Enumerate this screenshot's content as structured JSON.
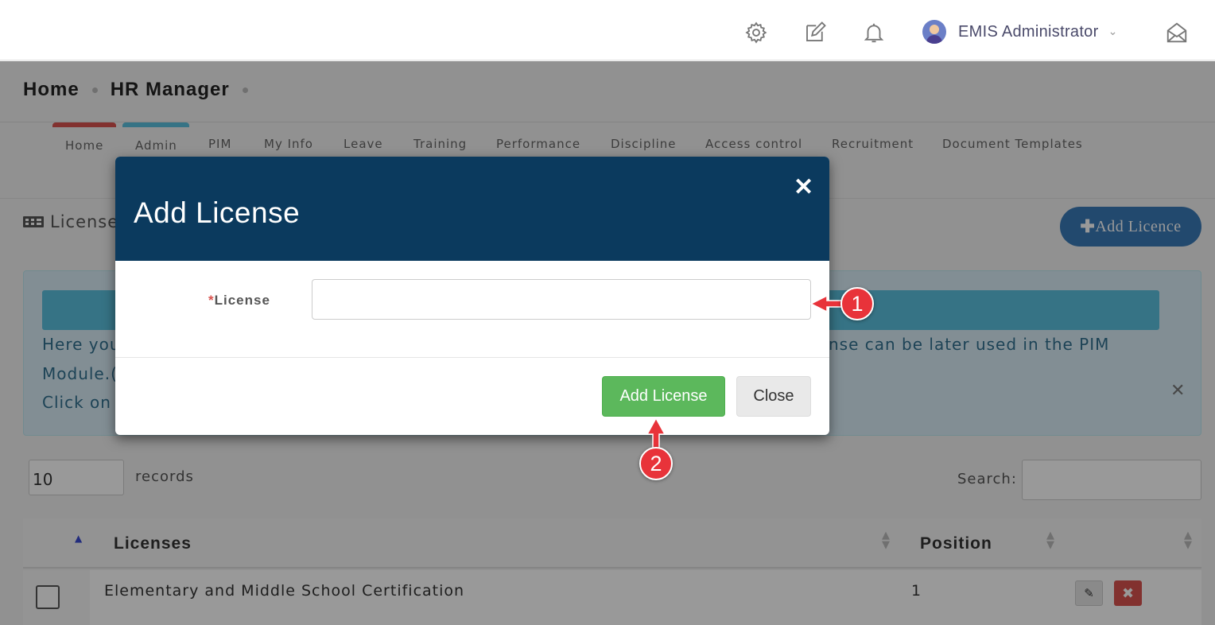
{
  "topbar": {
    "icons": [
      "gear-icon",
      "edit-icon",
      "bell-icon",
      "envelope-open-icon"
    ],
    "user_name": "EMIS Administrator"
  },
  "breadcrumb": {
    "home": "Home",
    "current": "HR Manager"
  },
  "tabs": [
    {
      "label": "Home"
    },
    {
      "label": "Admin"
    },
    {
      "label": "PIM"
    },
    {
      "label": "My Info"
    },
    {
      "label": "Leave"
    },
    {
      "label": "Training"
    },
    {
      "label": "Performance"
    },
    {
      "label": "Discipline"
    },
    {
      "label": "Access control"
    },
    {
      "label": "Recruitment"
    },
    {
      "label": "Document Templates"
    }
  ],
  "section": {
    "title": "License",
    "add_button": "Add Licence",
    "add_icon": "plus-icon"
  },
  "info": {
    "line1_left": "Here you",
    "line1_right": "nse can be later used in the PIM",
    "line2": "Module.(",
    "line3": "Click on"
  },
  "table_controls": {
    "records_value": "10",
    "records_label": "records",
    "search_label": "Search:"
  },
  "table": {
    "columns": [
      "Licenses",
      "Position"
    ],
    "rows": [
      {
        "license": "Elementary and Middle School Certification",
        "position": "1"
      }
    ]
  },
  "modal": {
    "title": "Add License",
    "field_required_mark": "*",
    "field_label": "License",
    "field_value": "",
    "add_button": "Add License",
    "close_button": "Close"
  },
  "callouts": {
    "first": "1",
    "second": "2",
    "color": "#e8333a"
  },
  "colors": {
    "modal_header": "#0b3a5e",
    "add_button": "#5cb85c",
    "accent_blue": "#3a7ab8"
  }
}
